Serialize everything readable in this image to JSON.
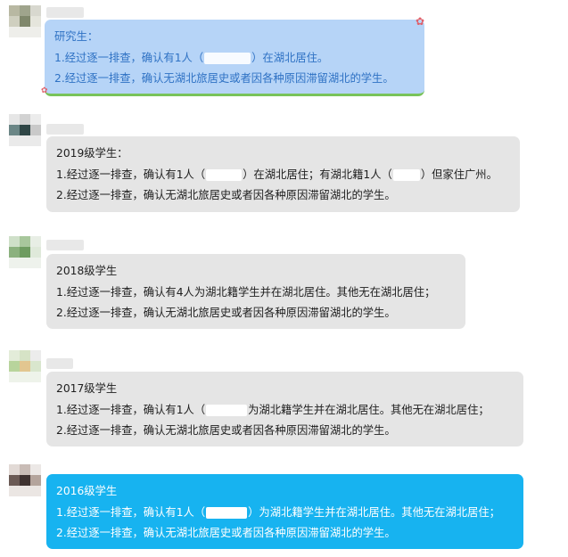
{
  "messages": [
    {
      "title": "研究生：",
      "line1_pre": "1.经过逐一排查，确认有1人（",
      "line1_post": "）在湖北居住。",
      "line2": "2.经过逐一排查，确认无湖北旅居史或者因各种原因滞留湖北的学生。"
    },
    {
      "title": "2019级学生：",
      "line1_pre": "1.经过逐一排查，确认有1人（",
      "line1_mid": "）在湖北居住；有湖北籍1人（",
      "line1_post": "）但家住广州。",
      "line2": "2.经过逐一排查，确认无湖北旅居史或者因各种原因滞留湖北的学生。"
    },
    {
      "title": "2018级学生",
      "line1": "1.经过逐一排查，确认有4人为湖北籍学生并在湖北居住。其他无在湖北居住；",
      "line2": "2.经过逐一排查，确认无湖北旅居史或者因各种原因滞留湖北的学生。"
    },
    {
      "title": "2017级学生",
      "line1_pre": "1.经过逐一排查，确认有1人（",
      "line1_post": "为湖北籍学生并在湖北居住。其他无在湖北居住；",
      "line2": "2.经过逐一排查，确认无湖北旅居史或者因各种原因滞留湖北的学生。"
    },
    {
      "title": "2016级学生",
      "line1_pre": "1.经过逐一排查，确认有1人（",
      "line1_post": "）为湖北籍学生并在湖北居住。其他无在湖北居住；",
      "line2": "2.经过逐一排查，确认无湖北旅居史或者因各种原因滞留湖北的学生。"
    }
  ],
  "colors": {
    "bubble_gray": "#e5e5e5",
    "bubble_first": "#b6d4f7",
    "bubble_first_text": "#2f72c4",
    "bubble_last": "#17b3f0",
    "bubble_last_text": "#ffffff"
  }
}
